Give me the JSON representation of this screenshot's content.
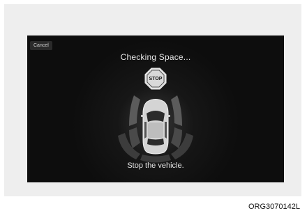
{
  "screen": {
    "cancel_label": "Cancel",
    "title": "Checking Space...",
    "stop_sign_text": "STOP",
    "message": "Stop the vehicle."
  },
  "image_code": "ORG3070142L",
  "icons": [
    "stop-sign-icon",
    "car-topview-icon",
    "parking-sensor-zones"
  ],
  "colors": {
    "screen_bg": "#0d0d0d",
    "text": "#e6e6e6",
    "stop_sign": "#d9d9d9"
  }
}
